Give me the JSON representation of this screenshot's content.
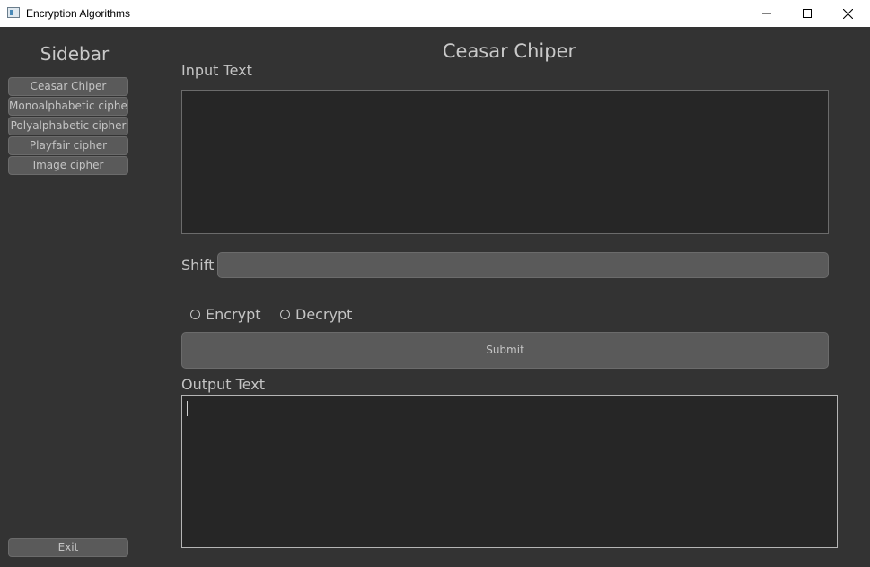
{
  "window": {
    "title": "Encryption Algorithms",
    "icon": "app-window-icon",
    "controls": [
      "minimize-icon",
      "maximize-icon",
      "close-icon"
    ]
  },
  "sidebar": {
    "title": "Sidebar",
    "items": [
      {
        "label": "Ceasar Chiper"
      },
      {
        "label": "Monoalphabetic cipher"
      },
      {
        "label": "Polyalphabetic cipher"
      },
      {
        "label": "Playfair cipher"
      },
      {
        "label": "Image cipher"
      }
    ],
    "exit_label": "Exit"
  },
  "main": {
    "title": "Ceasar Chiper",
    "input_label": "Input Text",
    "input_value": "",
    "shift_label": "Shift",
    "shift_value": "",
    "mode_options": [
      {
        "label": "Encrypt",
        "selected": false
      },
      {
        "label": "Decrypt",
        "selected": false
      }
    ],
    "submit_label": "Submit",
    "output_label": "Output Text",
    "output_value": ""
  },
  "colors": {
    "background": "#333333",
    "button": "#5a5a5a",
    "text_area": "#262626",
    "text": "#c4c4c4"
  }
}
